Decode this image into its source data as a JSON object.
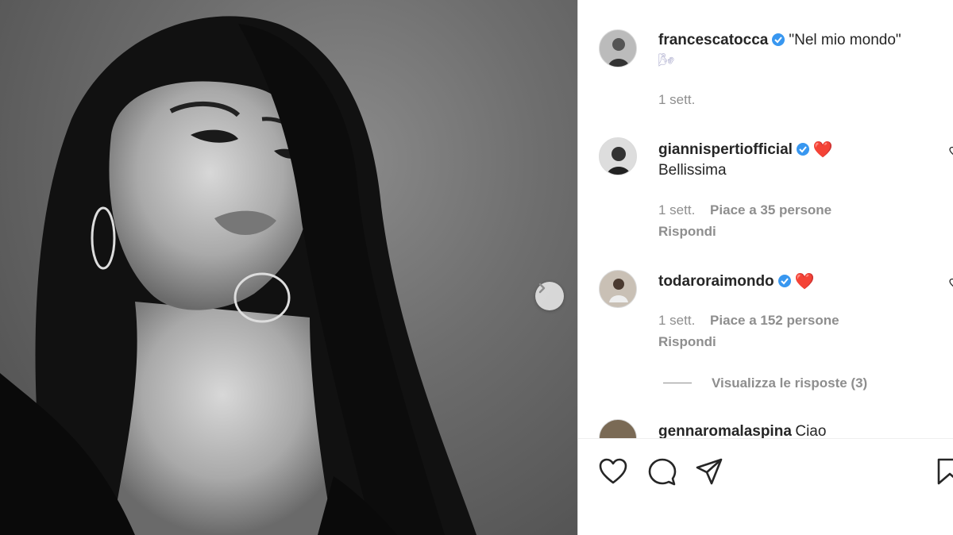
{
  "post": {
    "author": "francescatocca",
    "caption": "\"Nel mio mondo\"",
    "caption_emoji": "🌬",
    "time": "1 sett."
  },
  "comments": [
    {
      "user": "giannispertiofficial",
      "emoji": "❤️",
      "text": "Bellissima",
      "time": "1 sett.",
      "likes": "Piace a 35 persone",
      "reply": "Rispondi"
    },
    {
      "user": "todaroraimondo",
      "emoji": "❤️",
      "text": "",
      "time": "1 sett.",
      "likes": "Piace a 152 persone",
      "reply": "Rispondi",
      "view_replies": "Visualizza le risposte (3)"
    },
    {
      "user": "gennaromalaspina",
      "text": "Ciao"
    }
  ],
  "colors": {
    "verified": "#3897f0",
    "heart": "#e0162b",
    "meta": "#8e8e8e",
    "text": "#262626"
  },
  "icons": [
    "heart-icon",
    "comment-icon",
    "share-icon",
    "bookmark-icon",
    "chevron-right-icon",
    "verified-icon"
  ]
}
